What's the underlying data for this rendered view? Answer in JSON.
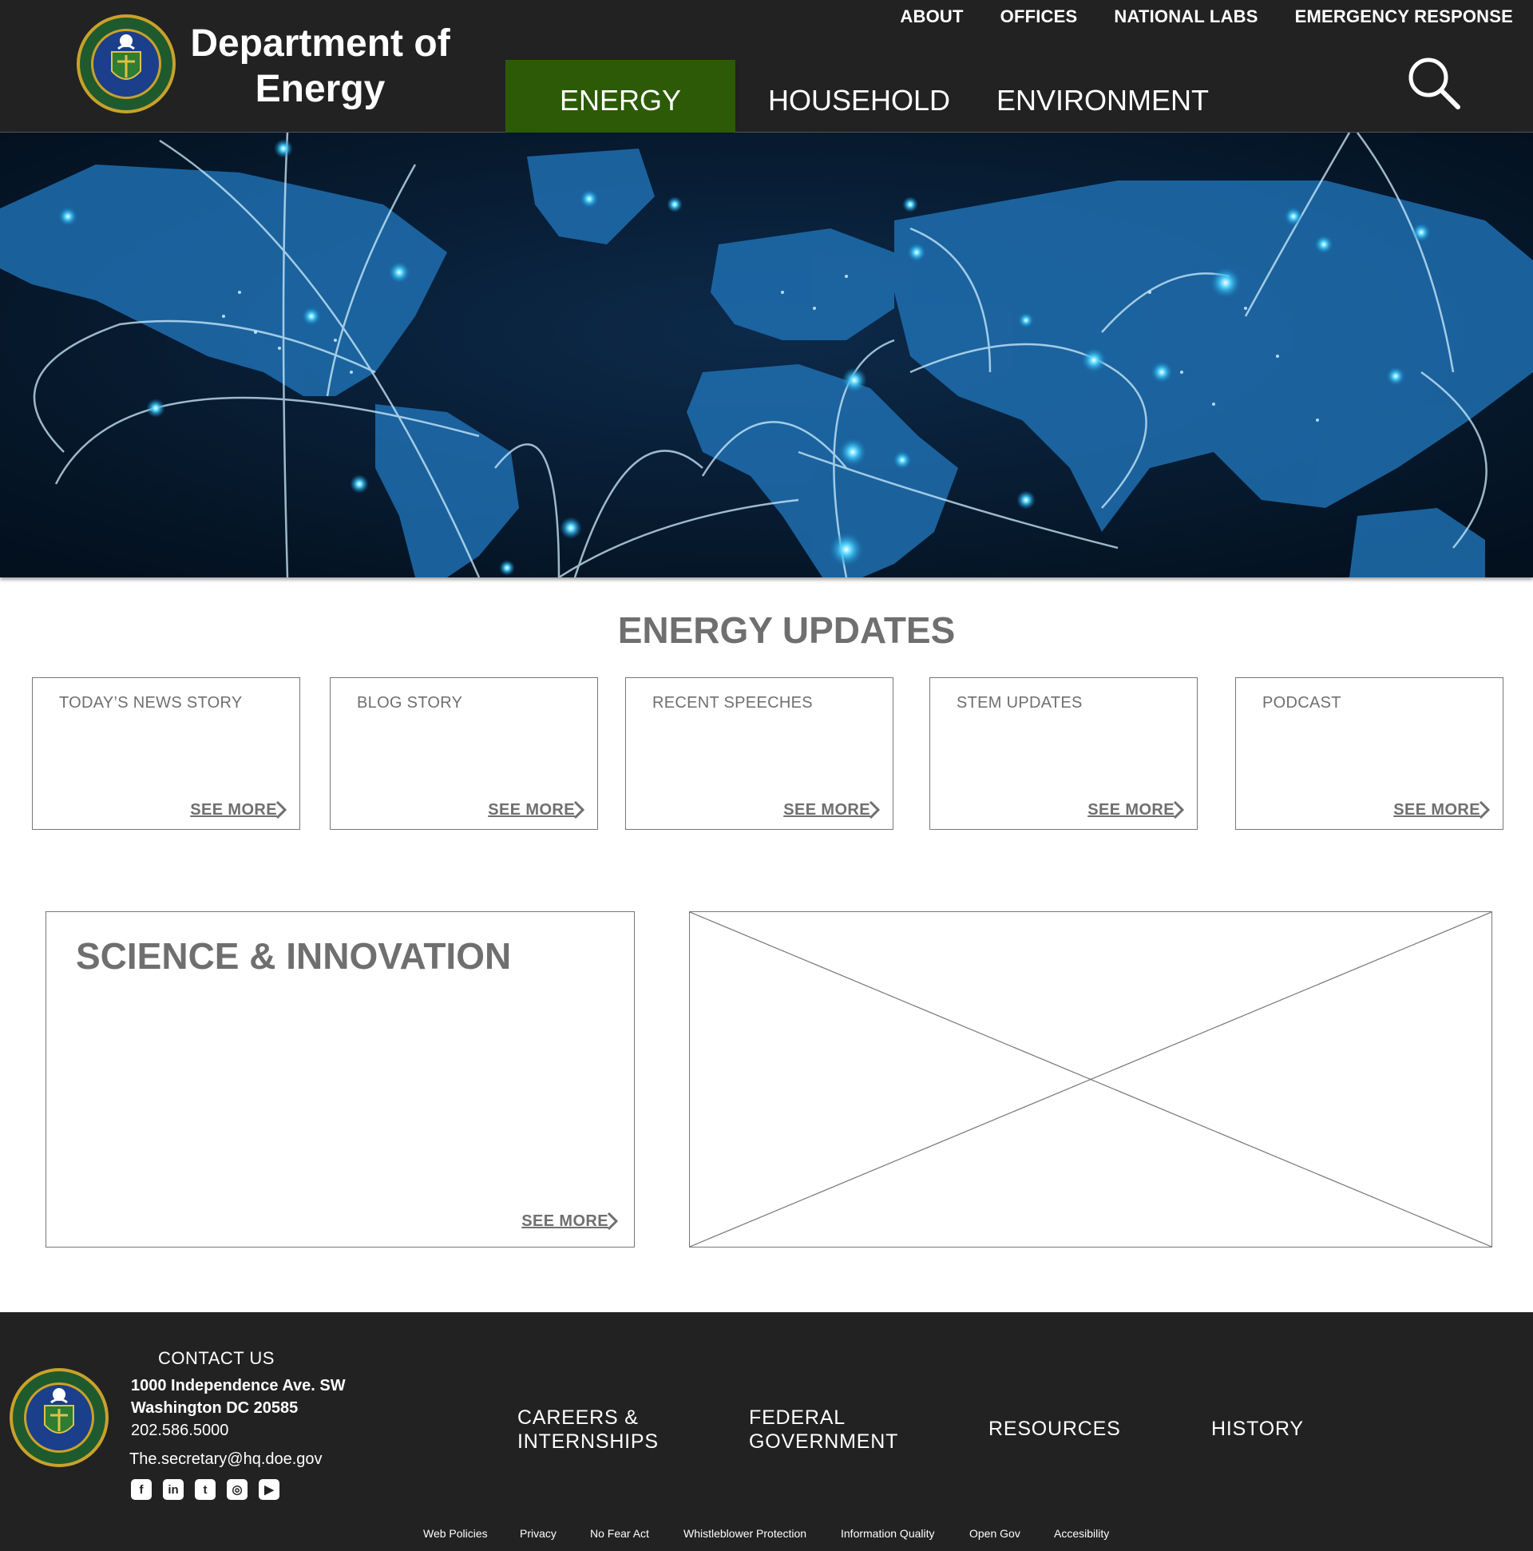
{
  "header": {
    "brand_line1": "Department of",
    "brand_line2": "Energy",
    "utility_nav": [
      "ABOUT",
      "OFFICES",
      "NATIONAL LABS",
      "EMERGENCY RESPONSE"
    ],
    "main_nav": [
      "ENERGY",
      "HOUSEHOLD",
      "ENVIRONMENT"
    ],
    "active_nav": "ENERGY",
    "seal_icon": "doe-seal-icon",
    "search_icon": "search-icon"
  },
  "hero": {
    "image": "night-world-map-network-image"
  },
  "updates": {
    "title": "ENERGY UPDATES",
    "cards": [
      {
        "label": "TODAY’S NEWS STORY",
        "more": "SEE MORE"
      },
      {
        "label": "BLOG STORY",
        "more": "SEE MORE"
      },
      {
        "label": "RECENT SPEECHES",
        "more": "SEE MORE"
      },
      {
        "label": "STEM UPDATES",
        "more": "SEE MORE"
      },
      {
        "label": "PODCAST",
        "more": "SEE MORE"
      }
    ]
  },
  "feature": {
    "title": "SCIENCE & INNOVATION",
    "more": "SEE MORE",
    "placeholder_icon": "image-placeholder-icon"
  },
  "footer": {
    "contact_title": "CONTACT US",
    "address_line1": "1000 Independence Ave. SW",
    "address_line2": "Washington DC 20585",
    "phone": "202.586.5000",
    "email": "The.secretary@hq.doe.gov",
    "social_icons": [
      "facebook-icon",
      "linkedin-icon",
      "twitter-icon",
      "instagram-icon",
      "youtube-icon"
    ],
    "links": {
      "careers_line1": "CAREERS &",
      "careers_line2": "INTERNSHIPS",
      "federal_line1": "FEDERAL",
      "federal_line2": "GOVERNMENT",
      "resources": "RESOURCES",
      "history": "HISTORY"
    },
    "legal_links": [
      "Web Policies",
      "Privacy",
      "No Fear Act",
      "Whistleblower Protection",
      "Information Quality",
      "Open Gov",
      "Accesibility"
    ]
  },
  "colors": {
    "header_bg": "#222222",
    "active_nav_bg": "#2d5a06",
    "text_gray": "#6f6f6f",
    "border_gray": "#777777"
  }
}
